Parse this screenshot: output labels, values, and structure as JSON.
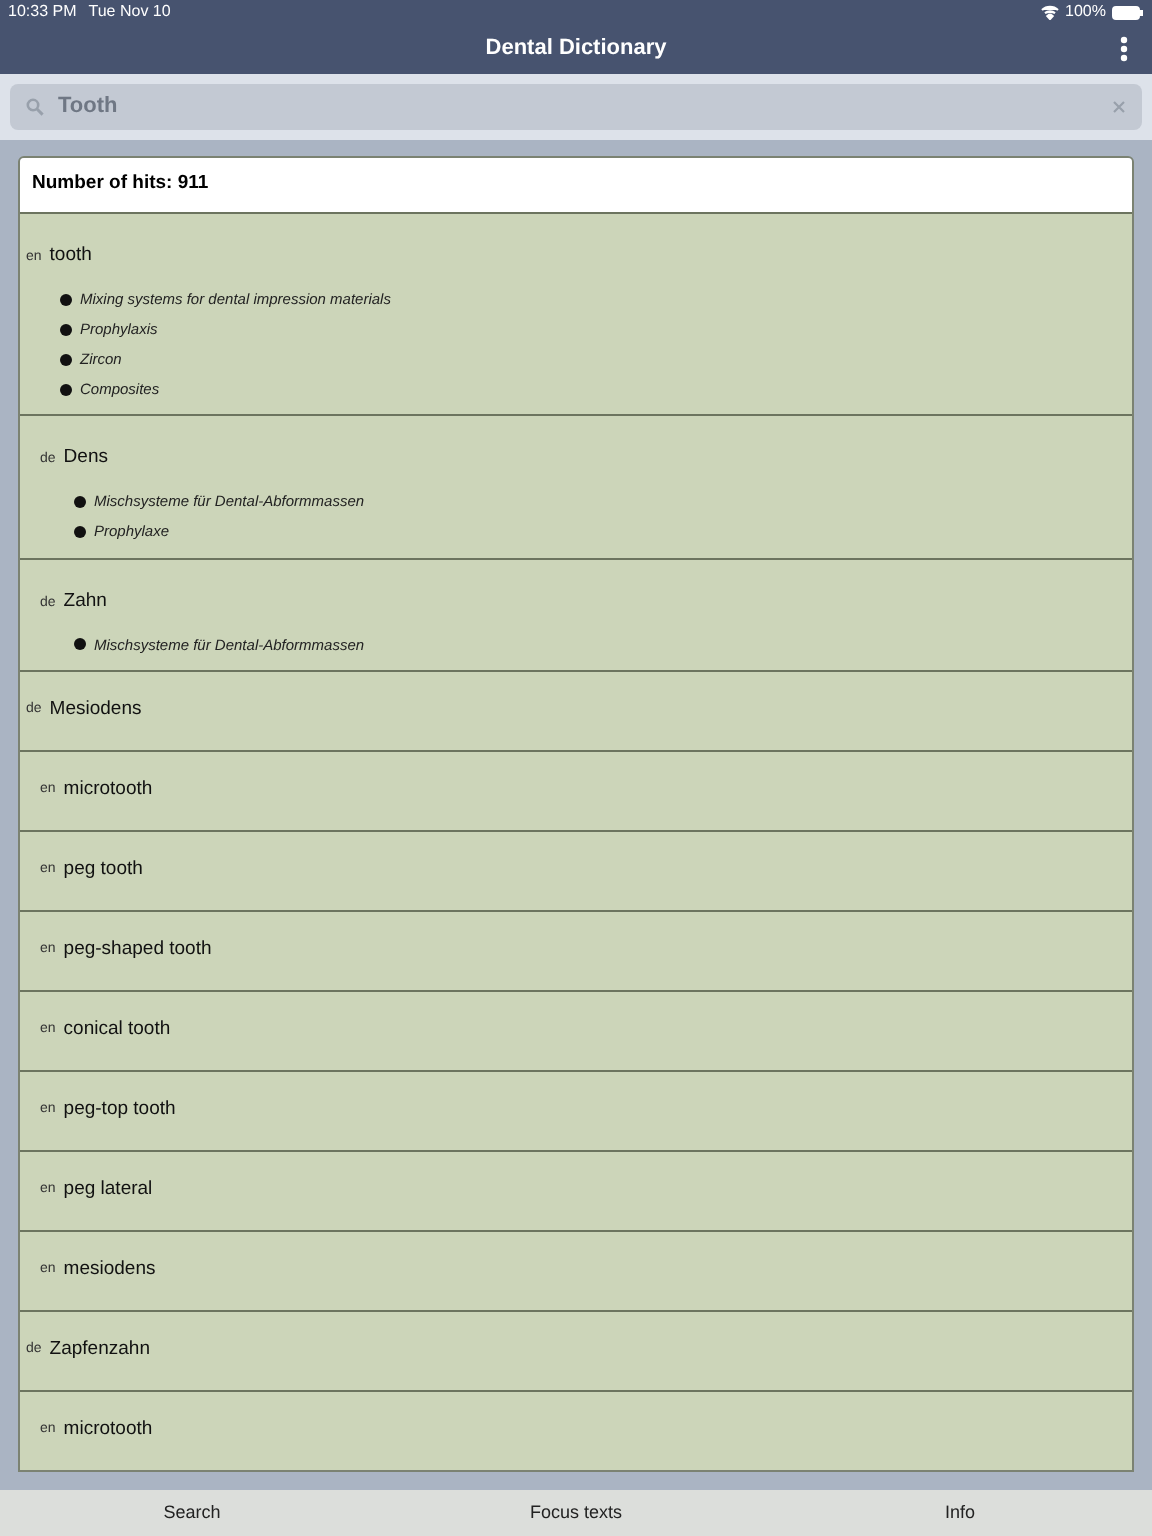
{
  "status_bar": {
    "time": "10:33 PM",
    "date": "Tue Nov 10",
    "battery": "100%"
  },
  "nav": {
    "title": "Dental Dictionary"
  },
  "search": {
    "value": "Tooth"
  },
  "hits": "Number of hits: 911",
  "entries": [
    {
      "lang": "en",
      "term": "tooth",
      "topics": [
        "Mixing systems for dental impression materials",
        "Prophylaxis",
        "Zircon",
        "Composites"
      ],
      "children": [
        {
          "lang": "de",
          "term": "Dens",
          "topics": [
            "Mischsysteme für Dental-Abformmassen",
            "Prophylaxe"
          ]
        },
        {
          "lang": "de",
          "term": "Zahn",
          "topics": [
            "Mischsysteme für Dental-Abformmassen"
          ]
        }
      ]
    },
    {
      "lang": "de",
      "term": "Mesiodens",
      "children": [
        {
          "lang": "en",
          "term": "microtooth"
        },
        {
          "lang": "en",
          "term": "peg tooth"
        },
        {
          "lang": "en",
          "term": "peg-shaped tooth"
        },
        {
          "lang": "en",
          "term": "conical tooth"
        },
        {
          "lang": "en",
          "term": "peg-top tooth"
        },
        {
          "lang": "en",
          "term": "peg lateral"
        },
        {
          "lang": "en",
          "term": "mesiodens"
        }
      ]
    },
    {
      "lang": "de",
      "term": "Zapfenzahn",
      "children": [
        {
          "lang": "en",
          "term": "microtooth"
        }
      ]
    }
  ],
  "tabs": [
    {
      "label": "Search"
    },
    {
      "label": "Focus texts"
    },
    {
      "label": "Info"
    }
  ]
}
